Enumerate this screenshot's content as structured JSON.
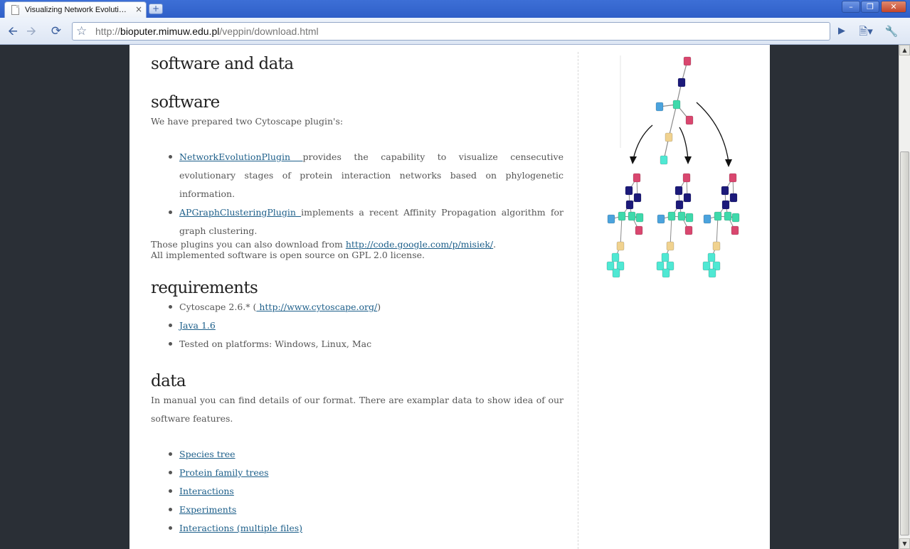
{
  "browser": {
    "tab_title": "Visualizing Network Evoluti…",
    "tab_close": "×",
    "new_tab": "+",
    "url_scheme": "http://",
    "url_host": "bioputer.mimuw.edu.pl",
    "url_path": "/veppin/download.html"
  },
  "page": {
    "title": "software and data",
    "software": {
      "heading": "software",
      "intro": "We have prepared two Cytoscape plugin's:",
      "plugins": [
        {
          "link": "NetworkEvolutionPlugin ",
          "text": "provides the capability to visualize censecutive evolutionary stages of protein interaction networks based on phylogenetic information."
        },
        {
          "link": "APGraphClusteringPlugin ",
          "text": "implements a recent Affinity Propagation algorithm for graph clustering."
        }
      ],
      "download_prefix": "Those plugins you can also download from ",
      "download_link": "http://code.google.com/p/misiek/",
      "download_suffix": ".",
      "license": "All implemented software is open source on GPL 2.0 license."
    },
    "requirements": {
      "heading": "requirements",
      "cytoscape_prefix": "Cytoscape 2.6.* (",
      "cytoscape_link": " http://www.cytoscape.org/",
      "cytoscape_suffix": ")",
      "java_link": "Java 1.6",
      "platforms": "Tested on platforms: Windows, Linux, Mac"
    },
    "data": {
      "heading": "data",
      "intro": "In manual you can find details of our format. There are examplar data to show idea of our software features.",
      "links": [
        "Species tree",
        "Protein family trees",
        "Interactions",
        "Experiments",
        "Interactions (multiple files)"
      ]
    }
  },
  "colors": {
    "link": "#1d5f8a",
    "node_red": "#d9476f",
    "node_navy": "#1c1a7a",
    "node_teal": "#3fd9ab",
    "node_blue": "#4ba3dd",
    "node_tan": "#f0d28f",
    "node_cyan": "#4fe8d3"
  }
}
